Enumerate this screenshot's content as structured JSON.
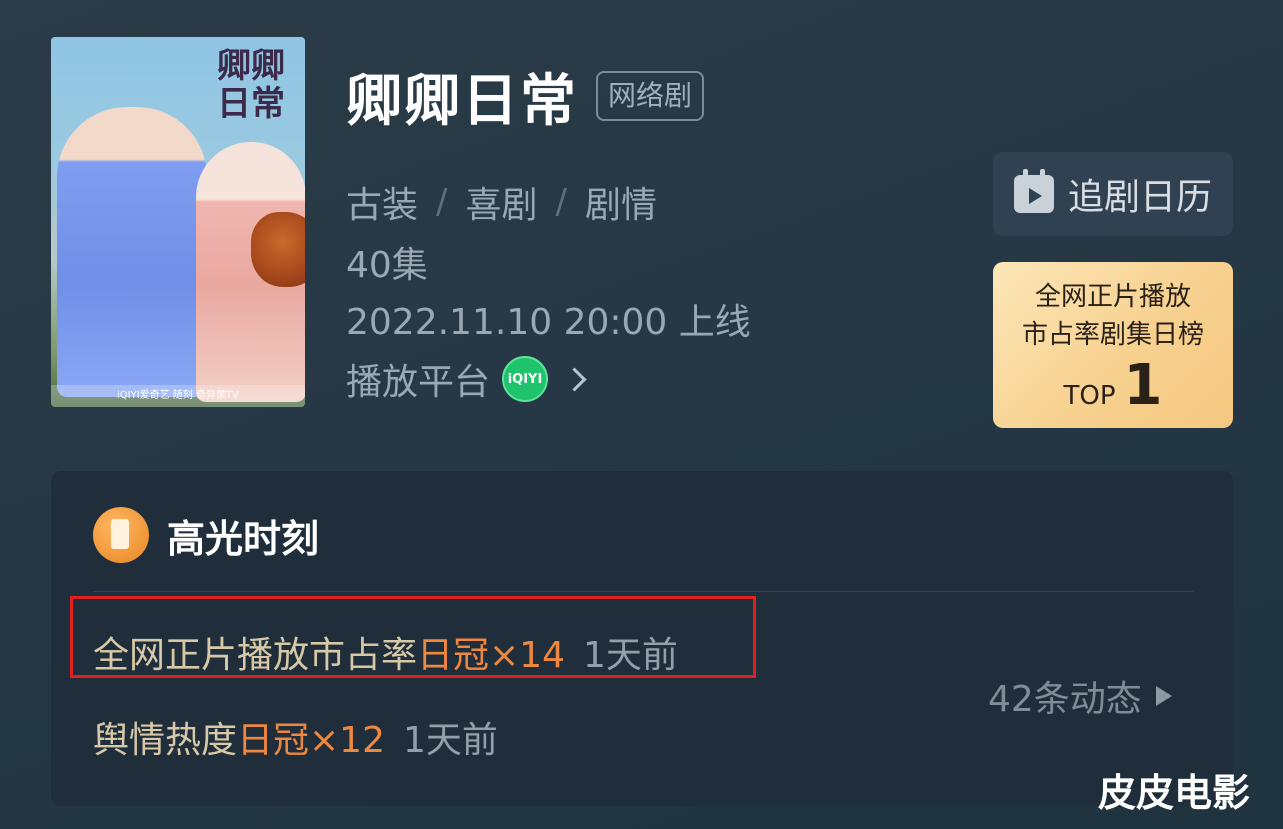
{
  "drama": {
    "title": "卿卿日常",
    "tag": "网络剧",
    "genres": [
      "古装",
      "喜剧",
      "剧情"
    ],
    "genre_separator": "/",
    "episodes": "40集",
    "release": "2022.11.10 20:00 上线",
    "platform_label": "播放平台",
    "platform_icon": "iqiyi-icon",
    "platform_icon_text": "iQIYI"
  },
  "poster": {
    "title_art": [
      "卿卿",
      "日常"
    ],
    "footer": "iQIYI爱奇艺 随刻 奇异果TV"
  },
  "calendar_button": {
    "label": "追剧日历",
    "icon": "calendar-play-icon"
  },
  "rank_card": {
    "line1": "全网正片播放",
    "line2": "市占率剧集日榜",
    "top_label": "TOP",
    "top_number": "1"
  },
  "highlights": {
    "title": "高光时刻",
    "icon": "lighthouse-icon",
    "items": [
      {
        "text": "全网正片播放市占率",
        "accent": "日冠×14",
        "time": "1天前"
      },
      {
        "text": "舆情热度",
        "accent": "日冠×12",
        "time": "1天前"
      }
    ],
    "updates_label": "42条动态"
  },
  "watermark": "皮皮电影",
  "colors": {
    "background": "#263845",
    "accent_orange": "#f0873e",
    "highlight_text": "#d7c9a7",
    "annotation_red": "#e02020",
    "rank_card_gold": "#f7d190"
  }
}
